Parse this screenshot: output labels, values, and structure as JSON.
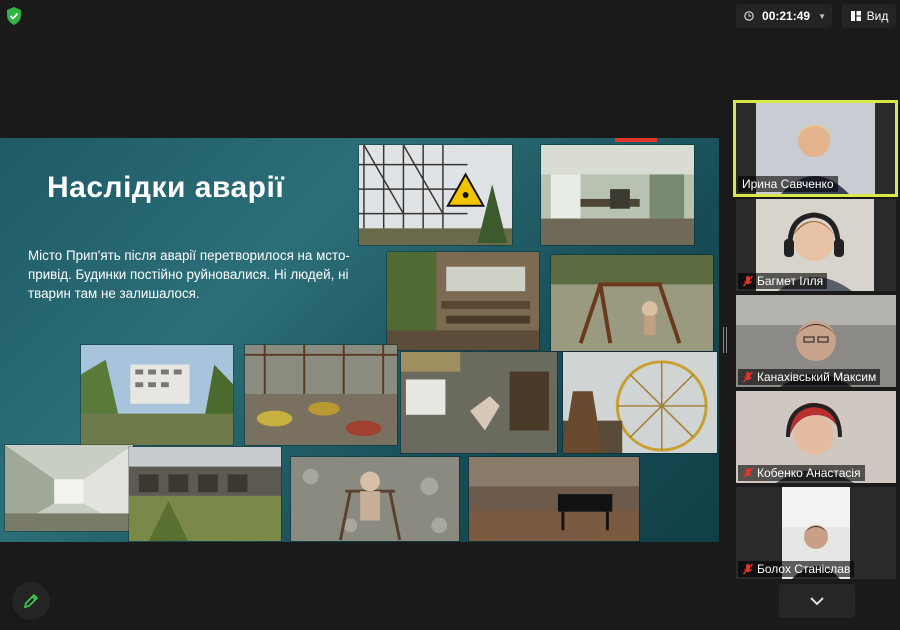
{
  "toolbar": {
    "timer": "00:21:49",
    "view_label": "Вид"
  },
  "slide": {
    "title": "Наслідки аварії",
    "text": "Місто Прип'ять після аварії  перетворилося на мсто-привід. Будинки постійно руйновалися. Ні людей, ні тварин там не залишалося."
  },
  "participants": [
    {
      "name": "Ирина Савченко",
      "muted": false,
      "active": true
    },
    {
      "name": "Багмет Ілля",
      "muted": true,
      "active": false
    },
    {
      "name": "Канахівський Максим",
      "muted": true,
      "active": false
    },
    {
      "name": "Кобенко Анастасія",
      "muted": true,
      "active": false
    },
    {
      "name": "Болох Станіслав",
      "muted": true,
      "active": false
    }
  ],
  "colors": {
    "active_speaker_border": "#d7e84a",
    "muted_icon": "#e0352b",
    "shield": "#2fb344",
    "slide_bg": "#1e5a66"
  },
  "icons": {
    "security": "shield-check-icon",
    "view": "grid-view-icon",
    "muted": "mic-off-icon",
    "scroll": "chevron-down-icon",
    "annotate": "pen-icon"
  }
}
